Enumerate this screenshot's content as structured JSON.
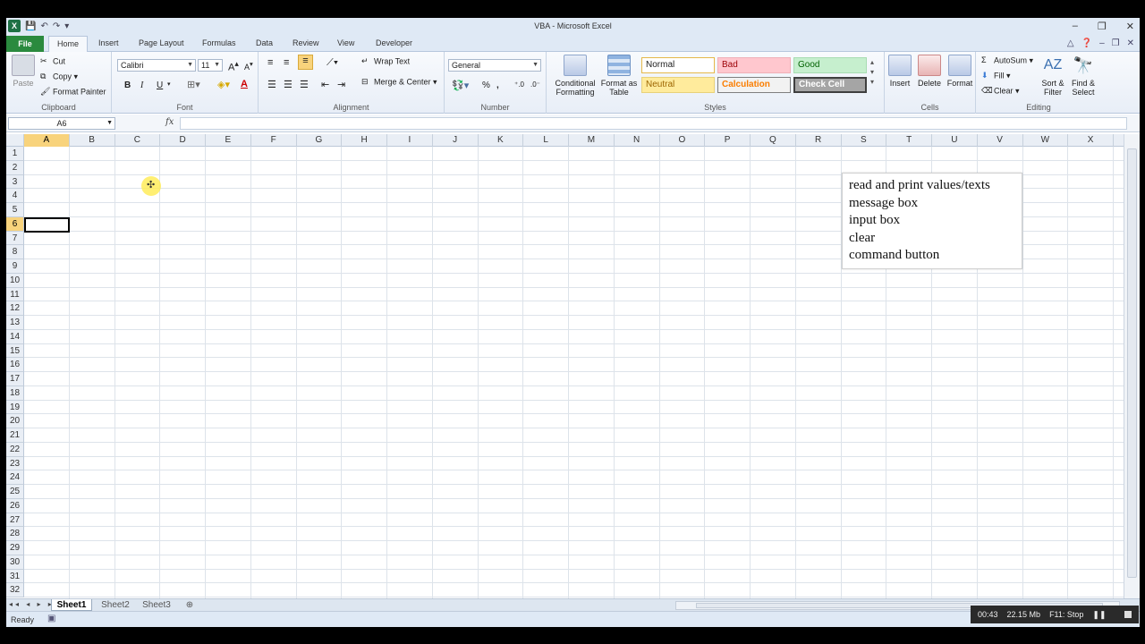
{
  "window": {
    "title": "VBA  -  Microsoft Excel"
  },
  "tabs": [
    "File",
    "Home",
    "Insert",
    "Page Layout",
    "Formulas",
    "Data",
    "Review",
    "View",
    "Developer"
  ],
  "clipboard": {
    "paste": "Paste",
    "cut": "Cut",
    "copy": "Copy",
    "format_painter": "Format Painter",
    "label": "Clipboard"
  },
  "font": {
    "name": "Calibri",
    "size": "11",
    "bold": "B",
    "italic": "I",
    "underline": "U",
    "label": "Font"
  },
  "alignment": {
    "wrap_text": "Wrap Text",
    "merge_center": "Merge & Center",
    "label": "Alignment"
  },
  "number": {
    "format": "General",
    "percent": "%",
    "comma": ",",
    "label": "Number"
  },
  "styles": {
    "conditional_formatting": "Conditional Formatting",
    "format_as_table": "Format as Table",
    "normal": "Normal",
    "bad": "Bad",
    "good": "Good",
    "neutral": "Neutral",
    "calculation": "Calculation",
    "check_cell": "Check Cell",
    "label": "Styles"
  },
  "cells": {
    "insert": "Insert",
    "delete": "Delete",
    "format": "Format",
    "label": "Cells"
  },
  "editing": {
    "autosum": "AutoSum",
    "fill": "Fill",
    "clear": "Clear",
    "sort_filter": "Sort & Filter",
    "find_select": "Find & Select",
    "label": "Editing"
  },
  "formula_bar": {
    "name_box": "A6",
    "fx": "fx",
    "content": ""
  },
  "grid": {
    "columns": [
      "A",
      "B",
      "C",
      "D",
      "E",
      "F",
      "G",
      "H",
      "I",
      "J",
      "K",
      "L",
      "M",
      "N",
      "O",
      "P",
      "Q",
      "R",
      "S",
      "T",
      "U",
      "V",
      "W",
      "X"
    ],
    "rows": [
      "1",
      "2",
      "3",
      "4",
      "5",
      "6",
      "7",
      "8",
      "9",
      "10",
      "11",
      "12",
      "13",
      "14",
      "15",
      "16",
      "17",
      "18",
      "19",
      "20",
      "21",
      "22",
      "23",
      "24",
      "25",
      "26",
      "27",
      "28",
      "29",
      "30",
      "31",
      "32"
    ],
    "selected_cell": "A6"
  },
  "notes": [
    "read and print values/texts",
    "message  box",
    "input box",
    "clear",
    "command button"
  ],
  "sheets": [
    "Sheet1",
    "Sheet2",
    "Sheet3"
  ],
  "status": {
    "ready": "Ready"
  },
  "recorder": {
    "time": "00:43",
    "size": "22.15 Mb",
    "stop_hint": "F11: Stop"
  }
}
